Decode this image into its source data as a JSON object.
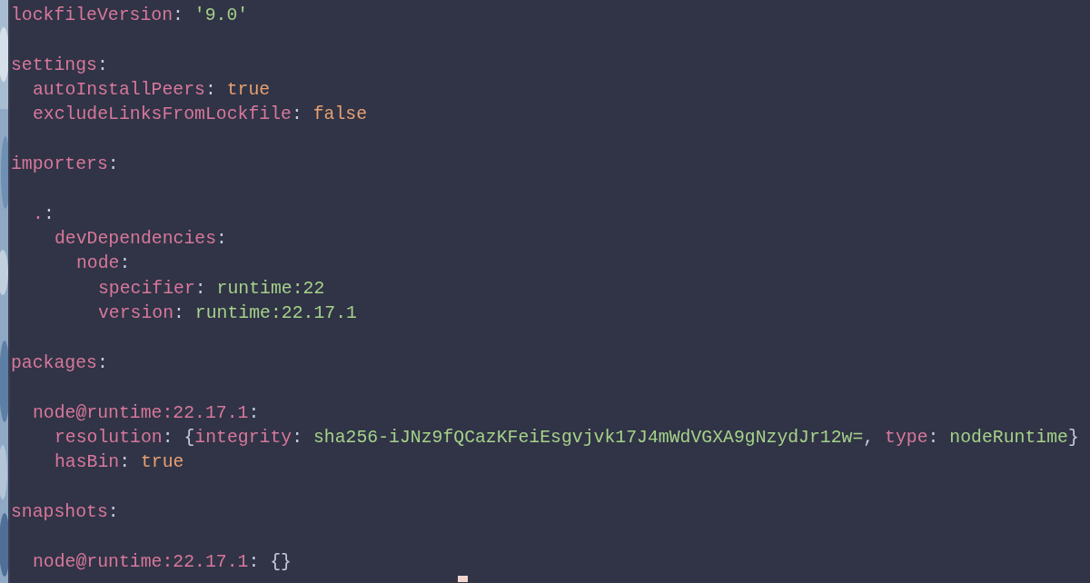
{
  "document": {
    "kind": "yaml",
    "nodes": [
      {
        "tokens": [
          {
            "text": "lockfileVersion",
            "kind": "key"
          },
          {
            "text": ": ",
            "kind": "punct"
          },
          {
            "text": "'9.0'",
            "kind": "string"
          }
        ]
      },
      {
        "kind": "compact",
        "tokens": [
          {
            "text": "settings",
            "kind": "key"
          },
          {
            "text": ":",
            "kind": "punct"
          }
        ],
        "children": [
          {
            "tokens": [
              {
                "text": "autoInstallPeers",
                "kind": "key"
              },
              {
                "text": ": ",
                "kind": "punct"
              },
              {
                "text": "true",
                "kind": "bool"
              }
            ]
          },
          {
            "tokens": [
              {
                "text": "excludeLinksFromLockfile",
                "kind": "key"
              },
              {
                "text": ": ",
                "kind": "punct"
              },
              {
                "text": "false",
                "kind": "bool"
              }
            ]
          }
        ]
      },
      {
        "kind": "spaced",
        "tokens": [
          {
            "text": "importers",
            "kind": "key"
          },
          {
            "text": ":",
            "kind": "punct"
          }
        ],
        "children": [
          {
            "tokens": [
              {
                "text": ".",
                "kind": "key"
              },
              {
                "text": ":",
                "kind": "punct"
              }
            ],
            "children": [
              {
                "tokens": [
                  {
                    "text": "devDependencies",
                    "kind": "key"
                  },
                  {
                    "text": ":",
                    "kind": "punct"
                  }
                ],
                "children": [
                  {
                    "tokens": [
                      {
                        "text": "node",
                        "kind": "key"
                      },
                      {
                        "text": ":",
                        "kind": "punct"
                      }
                    ],
                    "children": [
                      {
                        "tokens": [
                          {
                            "text": "specifier",
                            "kind": "key"
                          },
                          {
                            "text": ": ",
                            "kind": "punct"
                          },
                          {
                            "text": "runtime:22",
                            "kind": "string"
                          }
                        ]
                      },
                      {
                        "tokens": [
                          {
                            "text": "version",
                            "kind": "key"
                          },
                          {
                            "text": ": ",
                            "kind": "punct"
                          },
                          {
                            "text": "runtime:22.17.1",
                            "kind": "string"
                          }
                        ]
                      }
                    ]
                  }
                ]
              }
            ]
          }
        ]
      },
      {
        "kind": "spaced",
        "tokens": [
          {
            "text": "packages",
            "kind": "key"
          },
          {
            "text": ":",
            "kind": "punct"
          }
        ],
        "children": [
          {
            "tokens": [
              {
                "text": "node@runtime:22.17.1",
                "kind": "key"
              },
              {
                "text": ":",
                "kind": "punct"
              }
            ],
            "children": [
              {
                "tokens": [
                  {
                    "text": "resolution",
                    "kind": "key"
                  },
                  {
                    "text": ": ",
                    "kind": "punct"
                  },
                  {
                    "text": "{",
                    "kind": "punct"
                  },
                  {
                    "text": "integrity",
                    "kind": "key"
                  },
                  {
                    "text": ": ",
                    "kind": "punct"
                  },
                  {
                    "text": "sha256-iJNz9fQCazKFeiEsgvjvk17J4mWdVGXA9gNzydJr12w=",
                    "kind": "string"
                  },
                  {
                    "text": ", ",
                    "kind": "punct"
                  },
                  {
                    "text": "type",
                    "kind": "key"
                  },
                  {
                    "text": ": ",
                    "kind": "punct"
                  },
                  {
                    "text": "nodeRuntime",
                    "kind": "string"
                  },
                  {
                    "text": "}",
                    "kind": "punct"
                  }
                ]
              },
              {
                "tokens": [
                  {
                    "text": "hasBin",
                    "kind": "key"
                  },
                  {
                    "text": ": ",
                    "kind": "punct"
                  },
                  {
                    "text": "true",
                    "kind": "bool"
                  }
                ]
              }
            ]
          }
        ]
      },
      {
        "kind": "spaced",
        "tokens": [
          {
            "text": "snapshots",
            "kind": "key"
          },
          {
            "text": ":",
            "kind": "punct"
          }
        ],
        "children": [
          {
            "tokens": [
              {
                "text": "node@runtime:22.17.1",
                "kind": "key"
              },
              {
                "text": ": ",
                "kind": "punct"
              },
              {
                "text": "{}",
                "kind": "punct"
              }
            ]
          }
        ]
      }
    ]
  }
}
